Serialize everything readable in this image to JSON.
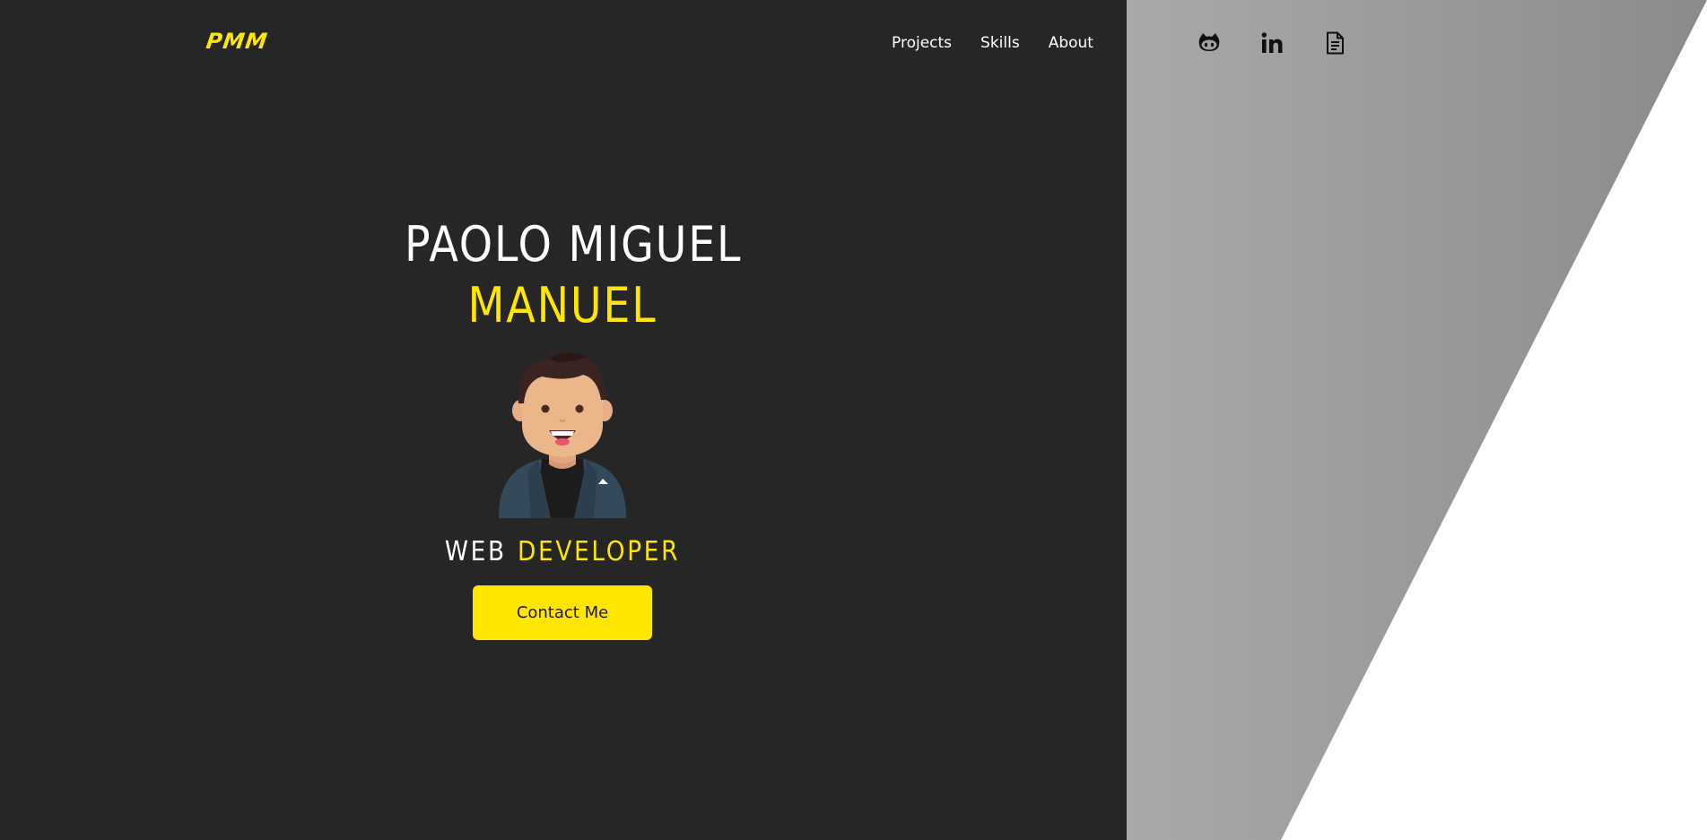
{
  "header": {
    "logo_text": "PMM",
    "nav": [
      {
        "label": "Projects"
      },
      {
        "label": "Skills"
      },
      {
        "label": "About"
      }
    ],
    "social": [
      {
        "icon": "github-icon"
      },
      {
        "icon": "linkedin-icon"
      },
      {
        "icon": "document-icon"
      }
    ]
  },
  "hero": {
    "name_first": "PAOLO MIGUEL",
    "name_last": "MANUEL",
    "role_prefix": "WEB",
    "role_highlight": "DEVELOPER",
    "cta_label": "Contact Me"
  },
  "colors": {
    "background": "#262626",
    "accent": "#ffe600",
    "text": "#ffffff",
    "panel_gray": "#9a9b9a"
  }
}
